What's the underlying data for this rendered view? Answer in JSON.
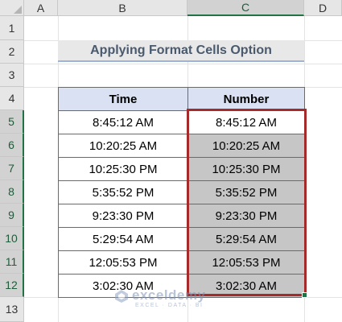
{
  "columns": [
    "A",
    "B",
    "C",
    "D"
  ],
  "rows": [
    "1",
    "2",
    "3",
    "4",
    "5",
    "6",
    "7",
    "8",
    "9",
    "10",
    "11",
    "12",
    "13"
  ],
  "title": "Applying Format Cells Option",
  "table": {
    "headers": [
      "Time",
      "Number"
    ],
    "time": [
      "8:45:12 AM",
      "10:20:25 AM",
      "10:25:30 PM",
      "5:35:52 PM",
      "9:23:30 PM",
      "5:29:54 AM",
      "12:05:53 PM",
      "3:02:30 AM"
    ],
    "number": [
      "8:45:12 AM",
      "10:20:25 AM",
      "10:25:30 PM",
      "5:35:52 PM",
      "9:23:30 PM",
      "5:29:54 AM",
      "12:05:53 PM",
      "3:02:30 AM"
    ]
  },
  "colors": {
    "header_fill": "#d9e1f2",
    "selected_fill": "#c6c6c6",
    "selection_border": "#a52a2a",
    "excel_green": "#217346"
  },
  "watermark": {
    "name": "exceldemy",
    "tagline": "EXCEL · DATA · BI"
  }
}
